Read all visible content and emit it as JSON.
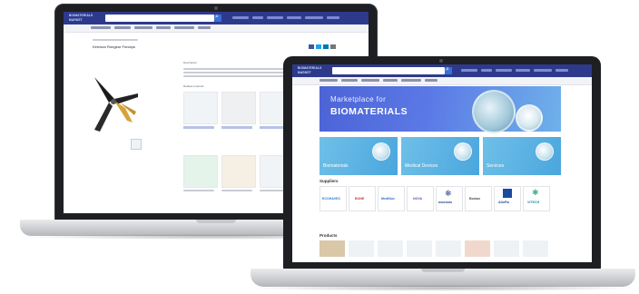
{
  "back_laptop": {
    "site_logo": "BIOMATERIALS MARKET",
    "page_title": "Kerrison Rongeur Forceps",
    "section_label": "Description",
    "related_label": "Related products",
    "product_icon": "surgical-rongeur-icon"
  },
  "front_laptop": {
    "site_logo": "BIOMATERIALS MARKET",
    "hero": {
      "line1": "Marketplace for",
      "line2": "BIOMATERIALS"
    },
    "tiles": [
      {
        "label": "Biomaterials"
      },
      {
        "label": "Medical Devices"
      },
      {
        "label": "Services"
      }
    ],
    "sections": {
      "suppliers": "Suppliers",
      "products": "Products"
    },
    "brands": [
      {
        "name": "ECOHAVEC",
        "color": "#2c7bd3"
      },
      {
        "name": "BONE",
        "color": "#c0392b"
      },
      {
        "name": "MedBlue",
        "color": "#3a6fc9"
      },
      {
        "name": "NOVA",
        "color": "#4b5bd0"
      },
      {
        "name": "neurosis",
        "color": "#1d3f7a"
      },
      {
        "name": "Bonlux",
        "color": "#444444"
      },
      {
        "name": "AlloFlo",
        "color": "#1a4aa0"
      },
      {
        "name": "VITECH",
        "color": "#1c8ea8"
      }
    ]
  },
  "colors": {
    "brand_header": "#2d3a8c",
    "hero_start": "#4c63d6",
    "hero_end": "#6fb1ea",
    "tile": "#5ab2e3",
    "laptop_bezel": "#1e1f22",
    "laptop_base": "#c9cbce"
  }
}
